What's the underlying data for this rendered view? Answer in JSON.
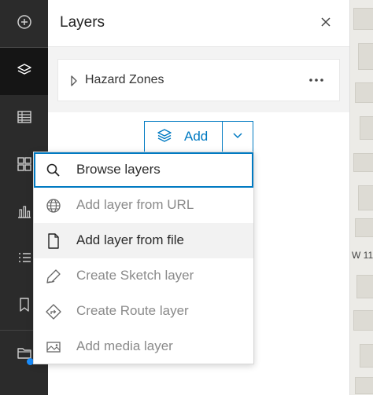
{
  "toolbar": {
    "items": [
      {
        "icon": "plus-circle-icon"
      },
      {
        "icon": "layers-icon",
        "active": true
      },
      {
        "icon": "table-icon"
      },
      {
        "icon": "grid-icon"
      },
      {
        "icon": "chart-icon"
      },
      {
        "icon": "list-icon"
      },
      {
        "icon": "bookmark-icon"
      },
      {
        "icon": "folder-icon"
      }
    ],
    "accent": "#1a8fff"
  },
  "panel": {
    "title": "Layers",
    "close_icon": "close-icon"
  },
  "layer": {
    "name": "Hazard Zones",
    "caret_icon": "caret-right-icon",
    "more_icon": "more-icon"
  },
  "add": {
    "label": "Add",
    "icon": "layers-add-icon",
    "dropdown_icon": "chevron-down-icon",
    "color": "#007ac2"
  },
  "menu": {
    "items": [
      {
        "label": "Browse layers",
        "icon": "search-icon",
        "state": "focused"
      },
      {
        "label": "Add layer from URL",
        "icon": "globe-icon",
        "state": "disabled"
      },
      {
        "label": "Add layer from file",
        "icon": "file-icon",
        "state": "hover"
      },
      {
        "label": "Create Sketch layer",
        "icon": "pencil-icon",
        "state": "disabled"
      },
      {
        "label": "Create Route layer",
        "icon": "route-icon",
        "state": "disabled"
      },
      {
        "label": "Add media layer",
        "icon": "image-icon",
        "state": "disabled"
      }
    ]
  },
  "map": {
    "street_label": "W 11"
  }
}
